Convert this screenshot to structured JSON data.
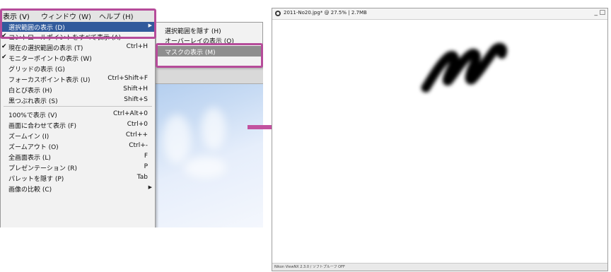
{
  "menubar": {
    "items": [
      "表示 (V)",
      "ウィンドウ (W)",
      "ヘルプ (H)"
    ]
  },
  "view_menu": {
    "items": [
      {
        "label": "選択範囲の表示 (D)",
        "shortcut": "",
        "checked": false,
        "submenu": true,
        "highlighted": true
      },
      {
        "label": "コントロールポイントをすべて表示 (A)",
        "shortcut": "",
        "checked": true,
        "submenu": false
      },
      {
        "label": "現在の選択範囲の表示 (T)",
        "shortcut": "Ctrl+H",
        "checked": true,
        "submenu": false
      },
      {
        "label": "モニターポイントの表示 (W)",
        "shortcut": "",
        "checked": true,
        "submenu": false
      },
      {
        "label": "グリッドの表示 (G)",
        "shortcut": "",
        "checked": false,
        "submenu": false
      },
      {
        "label": "フォーカスポイント表示 (U)",
        "shortcut": "Ctrl+Shift+F",
        "checked": false,
        "submenu": false
      },
      {
        "label": "白とび表示 (H)",
        "shortcut": "Shift+H",
        "checked": false,
        "submenu": false
      },
      {
        "label": "黒つぶれ表示 (S)",
        "shortcut": "Shift+S",
        "checked": false,
        "submenu": false
      },
      {
        "label": "100%で表示 (V)",
        "shortcut": "Ctrl+Alt+0",
        "checked": false,
        "submenu": false
      },
      {
        "label": "画面に合わせて表示 (F)",
        "shortcut": "Ctrl+0",
        "checked": false,
        "submenu": false
      },
      {
        "label": "ズームイン (I)",
        "shortcut": "Ctrl++",
        "checked": false,
        "submenu": false
      },
      {
        "label": "ズームアウト (O)",
        "shortcut": "Ctrl+-",
        "checked": false,
        "submenu": false
      },
      {
        "label": "全画面表示 (L)",
        "shortcut": "F",
        "checked": false,
        "submenu": false
      },
      {
        "label": "プレゼンテーション (R)",
        "shortcut": "P",
        "checked": false,
        "submenu": false
      },
      {
        "label": "パレットを隠す (P)",
        "shortcut": "Tab",
        "checked": false,
        "submenu": false
      },
      {
        "label": "画像の比較 (C)",
        "shortcut": "",
        "checked": false,
        "submenu": true
      }
    ]
  },
  "submenu": {
    "items": [
      {
        "label": "選択範囲を隠す (H)",
        "highlighted": false
      },
      {
        "label": "オーバーレイの表示 (O)",
        "highlighted": false
      },
      {
        "label": "マスクの表示 (M)",
        "highlighted": true
      }
    ]
  },
  "image_window": {
    "title": "2011-No20.jpg* @ 27.5% | 2.7MB",
    "minimize": "_",
    "maximize": "□",
    "status": "Nikon ViewNX 2.3.0 / ソフトプルーフ OFF"
  },
  "colors": {
    "highlight": "#315a9c",
    "accent_box": "#b64c9a",
    "arrow": "#c2529f"
  }
}
